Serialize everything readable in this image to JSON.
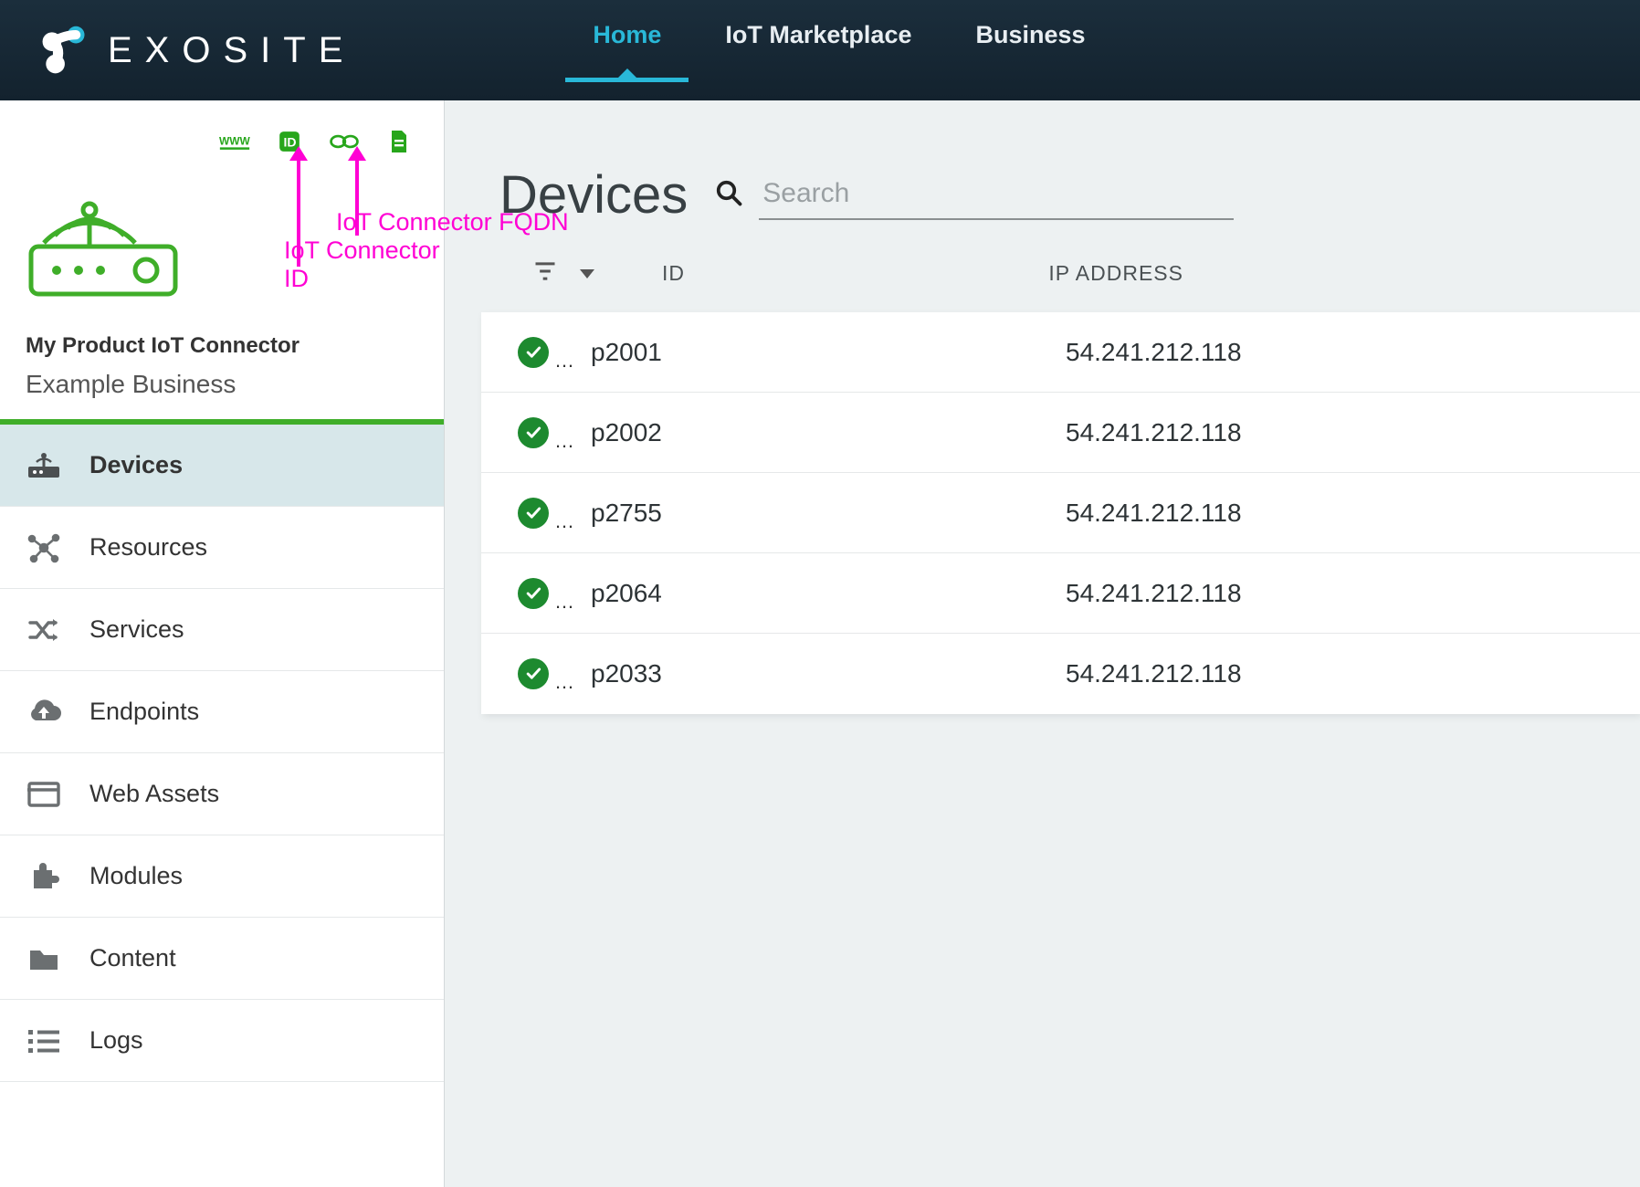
{
  "brand": "EXOSITE",
  "nav": {
    "items": [
      {
        "label": "Home",
        "active": true
      },
      {
        "label": "IoT Marketplace",
        "active": false
      },
      {
        "label": "Business",
        "active": false
      }
    ]
  },
  "sidebar": {
    "product_name": "My Product IoT Connector",
    "business_name": "Example Business",
    "connector_icons": [
      "www-icon",
      "id-badge-icon",
      "link-chain-icon",
      "document-icon"
    ],
    "menu": [
      {
        "label": "Devices",
        "icon": "device-icon",
        "active": true
      },
      {
        "label": "Resources",
        "icon": "graph-icon",
        "active": false
      },
      {
        "label": "Services",
        "icon": "shuffle-icon",
        "active": false
      },
      {
        "label": "Endpoints",
        "icon": "cloud-up-icon",
        "active": false
      },
      {
        "label": "Web Assets",
        "icon": "window-icon",
        "active": false
      },
      {
        "label": "Modules",
        "icon": "puzzle-icon",
        "active": false
      },
      {
        "label": "Content",
        "icon": "folder-icon",
        "active": false
      },
      {
        "label": "Logs",
        "icon": "list-icon",
        "active": false
      }
    ]
  },
  "annotations": {
    "id_label": "IoT Connector ID",
    "fqdn_label": "IoT Connector FQDN"
  },
  "main": {
    "title": "Devices",
    "search_placeholder": "Search",
    "columns": {
      "id": "ID",
      "ip": "IP ADDRESS"
    },
    "rows": [
      {
        "status": "ok",
        "id": "p2001",
        "ip": "54.241.212.118"
      },
      {
        "status": "ok",
        "id": "p2002",
        "ip": "54.241.212.118"
      },
      {
        "status": "ok",
        "id": "p2755",
        "ip": "54.241.212.118"
      },
      {
        "status": "ok",
        "id": "p2064",
        "ip": "54.241.212.118"
      },
      {
        "status": "ok",
        "id": "p2033",
        "ip": "54.241.212.118"
      }
    ]
  },
  "colors": {
    "accent": "#29b8d8",
    "green": "#3fae29",
    "status_ok": "#1d8a2f",
    "annotation": "#ff00d4"
  }
}
